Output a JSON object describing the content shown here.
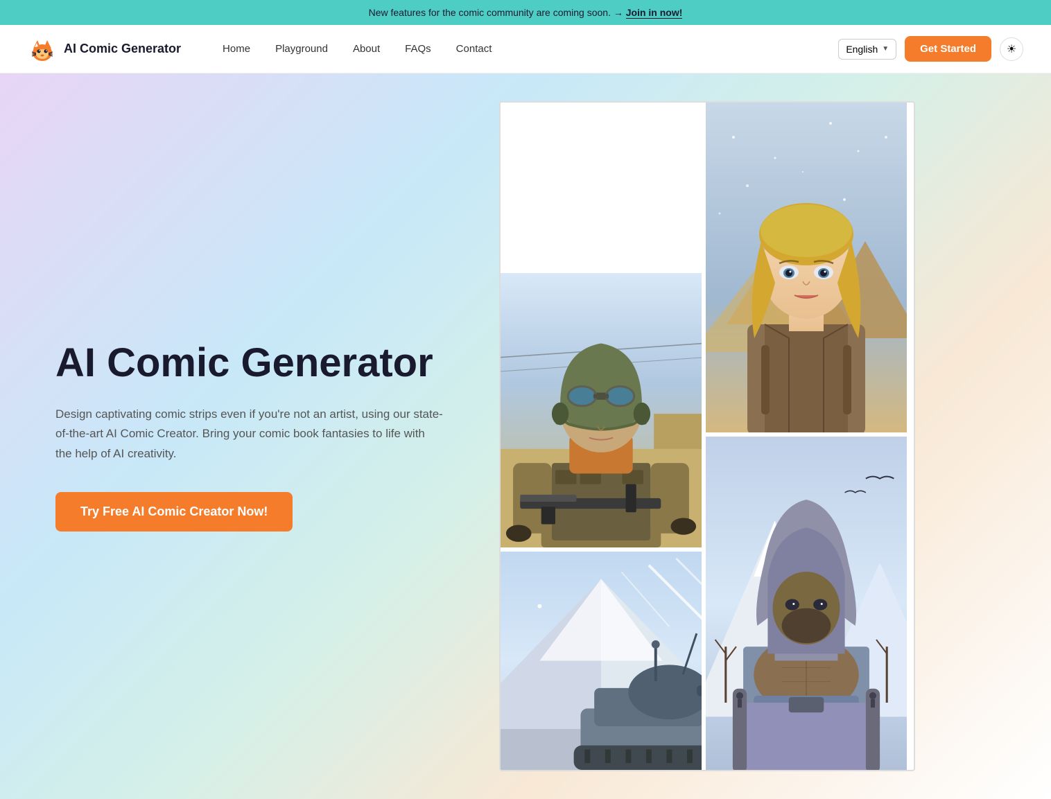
{
  "banner": {
    "text": "New features for the comic community are coming soon.",
    "arrow": "→",
    "link_text": "Join in now!"
  },
  "header": {
    "logo_text": "AI Comic Generator",
    "nav": {
      "home": "Home",
      "playground": "Playground",
      "about": "About",
      "faqs": "FAQs",
      "contact": "Contact"
    },
    "language": "English",
    "get_started": "Get Started",
    "theme_icon": "☀"
  },
  "hero": {
    "title": "AI Comic Generator",
    "description": "Design captivating comic strips even if you're not an artist, using our state-of-the-art AI Comic Creator. Bring your comic book fantasies to life with the help of AI creativity.",
    "cta_button": "Try Free AI Comic Creator Now!"
  }
}
